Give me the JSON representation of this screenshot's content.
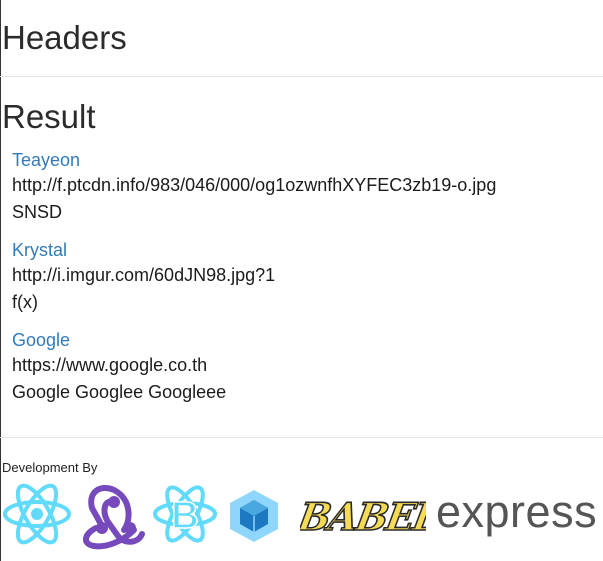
{
  "headers": {
    "title": "Headers"
  },
  "result": {
    "title": "Result",
    "items": [
      {
        "title": "Teayeon",
        "url": "http://f.ptcdn.info/983/046/000/og1ozwnfhXYFEC3zb19-o.jpg",
        "tags": "SNSD"
      },
      {
        "title": "Krystal",
        "url": "http://i.imgur.com/60dJN98.jpg?1",
        "tags": "f(x)"
      },
      {
        "title": "Google",
        "url": "https://www.google.co.th",
        "tags": "Google Googlee Googleee"
      }
    ]
  },
  "footer": {
    "label": "Development By",
    "logos": [
      {
        "icon": "react-logo-icon",
        "color": "#61dafb"
      },
      {
        "icon": "redux-logo-icon",
        "color": "#764abc"
      },
      {
        "icon": "react-bootstrap-logo-icon",
        "color": "#61dafb"
      },
      {
        "icon": "webpack-logo-icon",
        "color": "#8ed6fb"
      },
      {
        "icon": "babel-logo-icon",
        "color": "#f5da55",
        "text": "BABEL"
      },
      {
        "icon": "express-logo-icon",
        "color": "#555555",
        "text": "express"
      }
    ]
  }
}
